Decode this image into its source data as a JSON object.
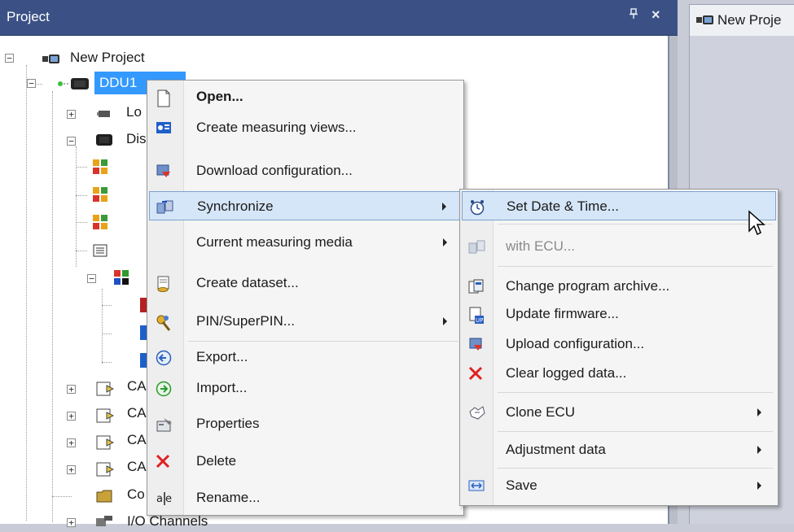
{
  "project_pane": {
    "title": "Project",
    "pin_glyph": "ᵖ",
    "close_glyph": "×"
  },
  "doc_tab": {
    "label": "New Proje"
  },
  "tree": {
    "root": "New Project",
    "selected": "DDU1",
    "items": [
      {
        "label": "Lo",
        "icon": "logger-icon"
      },
      {
        "label": "Dis",
        "icon": "display-icon"
      },
      {
        "label": "CA",
        "icon": "can-icon"
      },
      {
        "label": "CA",
        "icon": "can-icon"
      },
      {
        "label": "CA",
        "icon": "can-icon"
      },
      {
        "label": "CA",
        "icon": "can-icon"
      },
      {
        "label": "Co",
        "icon": "folder-icon"
      },
      {
        "label": "I/O Channels",
        "icon": "io-channels-icon"
      }
    ]
  },
  "context_menu": {
    "items": [
      {
        "label": "Open...",
        "icon": "open-icon",
        "bold": true
      },
      {
        "label": "Create measuring views...",
        "icon": "measuring-views-icon"
      },
      {
        "label": "Download configuration...",
        "icon": "download-icon"
      },
      {
        "label": "Synchronize",
        "icon": "synchronize-icon",
        "submenu": true,
        "highlighted": true
      },
      {
        "label": "Current measuring media",
        "submenu": true
      },
      {
        "label": "Create dataset...",
        "icon": "dataset-icon"
      },
      {
        "label": "PIN/SuperPIN...",
        "icon": "pin-icon",
        "submenu": true
      },
      {
        "label": "Export...",
        "icon": "export-icon"
      },
      {
        "label": "Import...",
        "icon": "import-icon"
      },
      {
        "label": "Properties",
        "icon": "properties-icon"
      },
      {
        "label": "Delete",
        "icon": "delete-icon"
      },
      {
        "label": "Rename...",
        "icon": "rename-icon"
      }
    ]
  },
  "sub_menu": {
    "items": [
      {
        "label": "Set Date & Time...",
        "icon": "clock-icon",
        "highlighted": true
      },
      {
        "label": "with ECU...",
        "icon": "sync-ecu-icon",
        "disabled": true
      },
      {
        "label": "Change program archive...",
        "icon": "archive-icon"
      },
      {
        "label": "Update firmware...",
        "icon": "firmware-icon"
      },
      {
        "label": "Upload configuration...",
        "icon": "upload-icon"
      },
      {
        "label": "Clear logged data...",
        "icon": "clear-icon"
      },
      {
        "label": "Clone ECU",
        "icon": "clone-icon",
        "submenu": true
      },
      {
        "label": "Adjustment data",
        "submenu": true
      },
      {
        "label": "Save",
        "icon": "save-icon",
        "submenu": true
      }
    ]
  },
  "colors": {
    "header": "#3b5185",
    "selection": "#3399ff",
    "menu_hot": "#d5e6f8",
    "delete_red": "#e02020"
  }
}
